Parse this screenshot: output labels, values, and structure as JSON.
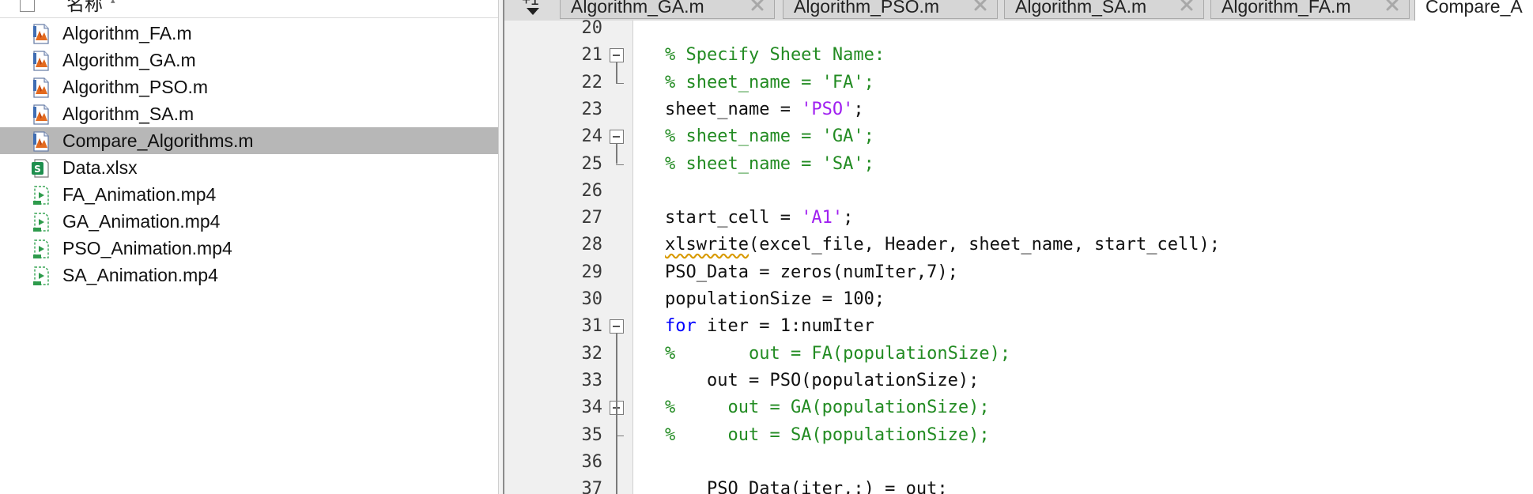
{
  "browser": {
    "column_name": "名称",
    "files": [
      {
        "name": "Algorithm_FA.m",
        "type": "m-file",
        "icon": "matlab-script-icon"
      },
      {
        "name": "Algorithm_GA.m",
        "type": "m-file",
        "icon": "matlab-script-icon"
      },
      {
        "name": "Algorithm_PSO.m",
        "type": "m-file",
        "icon": "matlab-script-icon"
      },
      {
        "name": "Algorithm_SA.m",
        "type": "m-file",
        "icon": "matlab-script-icon"
      },
      {
        "name": "Compare_Algorithms.m",
        "type": "m-file",
        "icon": "matlab-script-icon",
        "selected": true
      },
      {
        "name": "Data.xlsx",
        "type": "spreadsheet",
        "icon": "spreadsheet-icon"
      },
      {
        "name": "FA_Animation.mp4",
        "type": "video",
        "icon": "video-file-icon"
      },
      {
        "name": "GA_Animation.mp4",
        "type": "video",
        "icon": "video-file-icon"
      },
      {
        "name": "PSO_Animation.mp4",
        "type": "video",
        "icon": "video-file-icon"
      },
      {
        "name": "SA_Animation.mp4",
        "type": "video",
        "icon": "video-file-icon"
      }
    ]
  },
  "editor": {
    "tab_scroll_label": "+1",
    "tabs": [
      {
        "label": "Algorithm_GA.m",
        "active": false
      },
      {
        "label": "Algorithm_PSO.m",
        "active": false
      },
      {
        "label": "Algorithm_SA.m",
        "active": false
      },
      {
        "label": "Algorithm_FA.m",
        "active": false
      },
      {
        "label": "Compare_A",
        "active": true
      }
    ],
    "lines": [
      {
        "num": "20",
        "tokens": []
      },
      {
        "num": "21",
        "fold": "start",
        "tokens": [
          {
            "t": "cm",
            "v": "% Specify Sheet Name:"
          }
        ]
      },
      {
        "num": "22",
        "fold": "end",
        "tokens": [
          {
            "t": "cm",
            "v": "% sheet_name = 'FA';"
          }
        ]
      },
      {
        "num": "23",
        "tokens": [
          {
            "t": "plain",
            "v": "sheet_name = "
          },
          {
            "t": "str",
            "v": "'PSO'"
          },
          {
            "t": "plain",
            "v": ";"
          }
        ]
      },
      {
        "num": "24",
        "fold": "start",
        "tokens": [
          {
            "t": "cm",
            "v": "% sheet_name = 'GA';"
          }
        ]
      },
      {
        "num": "25",
        "fold": "end",
        "tokens": [
          {
            "t": "cm",
            "v": "% sheet_name = 'SA';"
          }
        ]
      },
      {
        "num": "26",
        "tokens": []
      },
      {
        "num": "27",
        "tokens": [
          {
            "t": "plain",
            "v": "start_cell = "
          },
          {
            "t": "str",
            "v": "'A1'"
          },
          {
            "t": "plain",
            "v": ";"
          }
        ]
      },
      {
        "num": "28",
        "tokens": [
          {
            "t": "warn",
            "v": "xlswrite"
          },
          {
            "t": "plain",
            "v": "(excel_file, Header, sheet_name, start_cell);"
          }
        ]
      },
      {
        "num": "29",
        "tokens": [
          {
            "t": "plain",
            "v": "PSO_Data = zeros(numIter,7);"
          }
        ]
      },
      {
        "num": "30",
        "tokens": [
          {
            "t": "plain",
            "v": "populationSize = 100;"
          }
        ]
      },
      {
        "num": "31",
        "fold": "start",
        "tokens": [
          {
            "t": "kw",
            "v": "for"
          },
          {
            "t": "plain",
            "v": " iter = 1:numIter"
          }
        ]
      },
      {
        "num": "32",
        "fold": "mid",
        "tokens": [
          {
            "t": "cm",
            "v": "%       out = FA(populationSize);"
          }
        ]
      },
      {
        "num": "33",
        "fold": "mid",
        "tokens": [
          {
            "t": "plain",
            "v": "    out = PSO(populationSize);"
          }
        ]
      },
      {
        "num": "34",
        "fold": "start",
        "tokens": [
          {
            "t": "cm",
            "v": "%     out = GA(populationSize);"
          }
        ]
      },
      {
        "num": "35",
        "fold": "end",
        "tokens": [
          {
            "t": "cm",
            "v": "%     out = SA(populationSize);"
          }
        ]
      },
      {
        "num": "36",
        "fold": "mid",
        "tokens": []
      },
      {
        "num": "37",
        "fold": "mid",
        "tokens": [
          {
            "t": "plain",
            "v": "    PSO_Data(iter,:) = out;"
          }
        ]
      }
    ]
  },
  "colors": {
    "comment": "#228b22",
    "string": "#a020f0",
    "keyword": "#0000ff",
    "selected_row": "#b7b7b7"
  }
}
